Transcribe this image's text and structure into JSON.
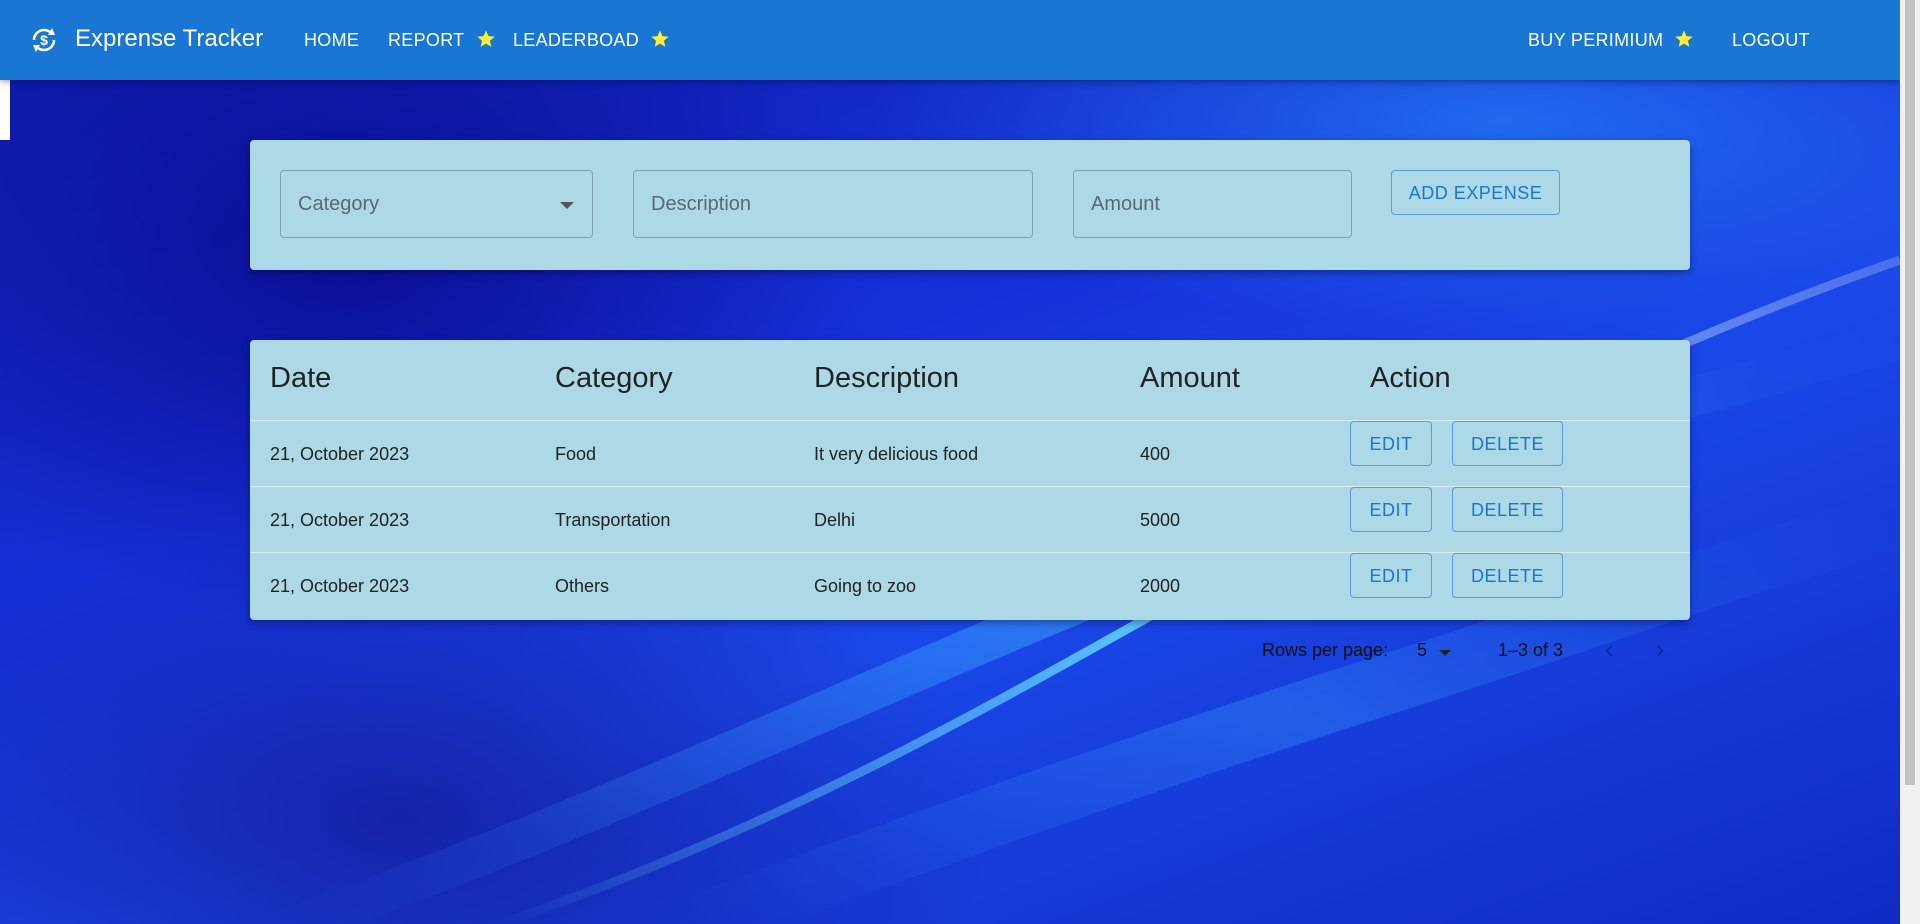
{
  "app": {
    "title": "Exprense Tracker",
    "nav": {
      "home": "HOME",
      "report": "REPORT",
      "leaderboard": "LEADERBOAD",
      "premium": "BUY PERIMIUM",
      "logout": "LOGOUT"
    }
  },
  "form": {
    "category_label": "Category",
    "description_placeholder": "Description",
    "amount_placeholder": "Amount",
    "add_button": "ADD EXPENSE"
  },
  "table": {
    "headers": [
      "Date",
      "Category",
      "Description",
      "Amount",
      "Action"
    ],
    "rows": [
      {
        "date": "21, October 2023",
        "category": "Food",
        "description": "It very delicious food",
        "amount": "400",
        "edit": "EDIT",
        "delete": "DELETE"
      },
      {
        "date": "21, October 2023",
        "category": "Transportation",
        "description": "Delhi",
        "amount": "5000",
        "edit": "EDIT",
        "delete": "DELETE"
      },
      {
        "date": "21, October 2023",
        "category": "Others",
        "description": "Going to zoo",
        "amount": "2000",
        "edit": "EDIT",
        "delete": "DELETE"
      }
    ]
  },
  "pagination": {
    "rows_label": "Rows per page:",
    "rows_value": "5",
    "range": "1–3 of 3"
  },
  "colors": {
    "appbar": "#1976d2",
    "card": "#add8e6",
    "accent": "#1976d2",
    "star": "#ffeb3b"
  }
}
